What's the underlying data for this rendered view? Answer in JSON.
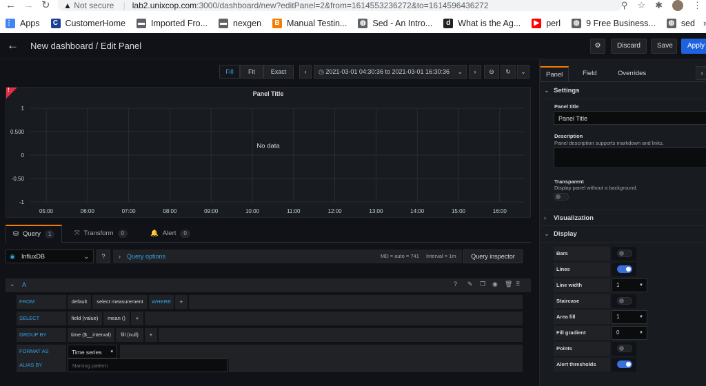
{
  "browser": {
    "security": "Not secure",
    "domain": "lab2.unixcop.com",
    "path": ":3000/dashboard/new?editPanel=2&from=1614553236272&to=1614596436272",
    "bookmarks": [
      {
        "label": "Apps",
        "color": "#4285f4",
        "glyph": "⋮⋮"
      },
      {
        "label": "CustomerHome",
        "color": "#1a3f8f",
        "glyph": "C"
      },
      {
        "label": "Imported Fro...",
        "color": "#5f6368",
        "glyph": "▬"
      },
      {
        "label": "nexgen",
        "color": "#5f6368",
        "glyph": "▬"
      },
      {
        "label": "Manual Testin...",
        "color": "#f57c00",
        "glyph": "B"
      },
      {
        "label": "Sed - An Intro...",
        "color": "#5f6368",
        "glyph": "◍"
      },
      {
        "label": "What is the Ag...",
        "color": "#202124",
        "glyph": "d"
      },
      {
        "label": "perl",
        "color": "#ff0000",
        "glyph": "▶"
      },
      {
        "label": "9 Free Business...",
        "color": "#5f6368",
        "glyph": "◍"
      },
      {
        "label": "sed",
        "color": "#5f6368",
        "glyph": "◍"
      }
    ]
  },
  "header": {
    "title": "New dashboard / Edit Panel",
    "discard": "Discard",
    "save": "Save",
    "apply": "Apply"
  },
  "toolbar": {
    "fill": "Fill",
    "fit": "Fit",
    "exact": "Exact",
    "time_range": "2021-03-01 04:30:36 to 2021-03-01 16:30:36"
  },
  "panel": {
    "title": "Panel Title",
    "no_data": "No data",
    "corner_mark": "!"
  },
  "chart_data": {
    "type": "line",
    "title": "Panel Title",
    "xlabel": "",
    "ylabel": "",
    "x_ticks": [
      "05:00",
      "06:00",
      "07:00",
      "08:00",
      "09:00",
      "10:00",
      "11:00",
      "12:00",
      "13:00",
      "14:00",
      "15:00",
      "16:00"
    ],
    "y_ticks": [
      "1",
      "0.500",
      "0",
      "-0.50",
      "-1"
    ],
    "ylim": [
      -1,
      1
    ],
    "series": [],
    "annotation": "No data",
    "grid": true
  },
  "query_tabs": [
    {
      "label": "Query",
      "count": "1"
    },
    {
      "label": "Transform",
      "count": "0"
    },
    {
      "label": "Alert",
      "count": "0"
    }
  ],
  "datasource": {
    "name": "InfluxDB",
    "query_options": "Query options",
    "md": "MD = auto = 741",
    "interval": "Interval = 1m",
    "inspector": "Query inspector"
  },
  "query": {
    "ref": "A",
    "from_key": "FROM",
    "from_default": "default",
    "from_measurement": "select measurement",
    "where": "WHERE",
    "select_key": "SELECT",
    "select_field": "field (value)",
    "select_mean": "mean ()",
    "groupby_key": "GROUP BY",
    "groupby_time": "time ($__interval)",
    "groupby_fill": "fill (null)",
    "format_key": "FORMAT AS",
    "format_value": "Time series",
    "alias_key": "ALIAS BY",
    "alias_placeholder": "Naming pattern",
    "plus": "+"
  },
  "options": {
    "tabs": [
      "Panel",
      "Field",
      "Overrides"
    ],
    "settings_title": "Settings",
    "panel_title_label": "Panel title",
    "panel_title_value": "Panel Title",
    "description_label": "Description",
    "description_hint": "Panel description supports markdown and links.",
    "transparent_label": "Transparent",
    "transparent_hint": "Display panel without a background.",
    "visualization_title": "Visualization",
    "display_title": "Display",
    "display": [
      {
        "label": "Bars",
        "kind": "toggle",
        "on": false
      },
      {
        "label": "Lines",
        "kind": "toggle",
        "on": true
      },
      {
        "label": "Line width",
        "kind": "select",
        "value": "1"
      },
      {
        "label": "Staircase",
        "kind": "toggle",
        "on": false
      },
      {
        "label": "Area fill",
        "kind": "select",
        "value": "1"
      },
      {
        "label": "Fill gradient",
        "kind": "select",
        "value": "0"
      },
      {
        "label": "Points",
        "kind": "toggle",
        "on": false
      },
      {
        "label": "Alert thresholds",
        "kind": "toggle",
        "on": true
      }
    ]
  }
}
